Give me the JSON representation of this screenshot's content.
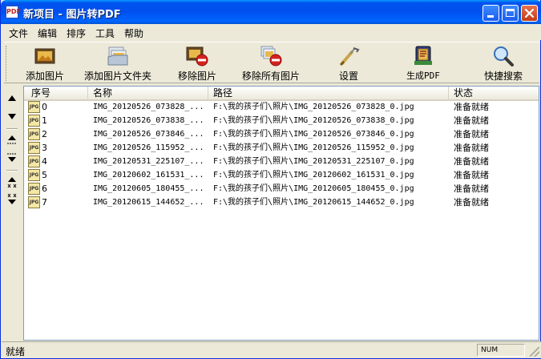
{
  "window": {
    "title": "新项目 - 图片转PDF",
    "app_icon_text": "PDF",
    "buttons": [
      "minimize",
      "maximize",
      "close"
    ]
  },
  "menu": {
    "items": [
      "文件",
      "编辑",
      "排序",
      "工具",
      "帮助"
    ]
  },
  "toolbar": {
    "buttons": [
      {
        "label": "添加图片",
        "icon": "add-image-icon"
      },
      {
        "label": "添加图片文件夹",
        "icon": "add-folder-icon"
      },
      {
        "label": "移除图片",
        "icon": "remove-image-icon"
      },
      {
        "label": "移除所有图片",
        "icon": "remove-all-icon"
      },
      {
        "label": "设置",
        "icon": "settings-icon"
      },
      {
        "label": "生成PDF",
        "icon": "generate-pdf-icon"
      },
      {
        "label": "快捷搜索",
        "icon": "search-icon"
      }
    ]
  },
  "sidebar": {
    "buttons": [
      "▲",
      "▼",
      "⤒",
      "⤓",
      "✖▲",
      "✖▼"
    ]
  },
  "list": {
    "columns": [
      "序号",
      "名称",
      "路径",
      "状态"
    ],
    "rows": [
      {
        "index": "0",
        "name": "IMG_20120526_073828_...",
        "path": "F:\\我的孩子们\\照片\\IMG_20120526_073828_0.jpg",
        "status": "准备就绪"
      },
      {
        "index": "1",
        "name": "IMG_20120526_073838_...",
        "path": "F:\\我的孩子们\\照片\\IMG_20120526_073838_0.jpg",
        "status": "准备就绪"
      },
      {
        "index": "2",
        "name": "IMG_20120526_073846_...",
        "path": "F:\\我的孩子们\\照片\\IMG_20120526_073846_0.jpg",
        "status": "准备就绪"
      },
      {
        "index": "3",
        "name": "IMG_20120526_115952_...",
        "path": "F:\\我的孩子们\\照片\\IMG_20120526_115952_0.jpg",
        "status": "准备就绪"
      },
      {
        "index": "4",
        "name": "IMG_20120531_225107_...",
        "path": "F:\\我的孩子们\\照片\\IMG_20120531_225107_0.jpg",
        "status": "准备就绪"
      },
      {
        "index": "5",
        "name": "IMG_20120602_161531_...",
        "path": "F:\\我的孩子们\\照片\\IMG_20120602_161531_0.jpg",
        "status": "准备就绪"
      },
      {
        "index": "6",
        "name": "IMG_20120605_180455_...",
        "path": "F:\\我的孩子们\\照片\\IMG_20120605_180455_0.jpg",
        "status": "准备就绪"
      },
      {
        "index": "7",
        "name": "IMG_20120615_144652_...",
        "path": "F:\\我的孩子们\\照片\\IMG_20120615_144652_0.jpg",
        "status": "准备就绪"
      }
    ],
    "row_icon_text": "JPG"
  },
  "statusbar": {
    "text": "就绪",
    "num": "NUM"
  },
  "colors": {
    "titlebar": "#0053EE",
    "close": "#C23A17",
    "face": "#ECE9D8"
  }
}
